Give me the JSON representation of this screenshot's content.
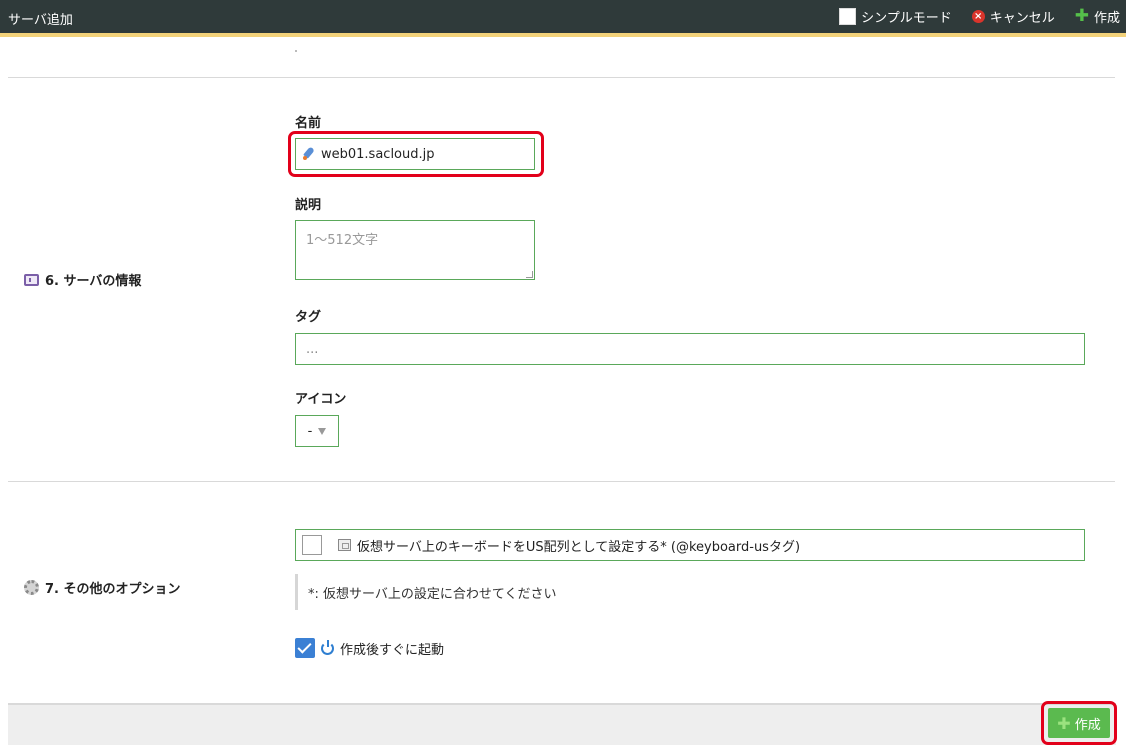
{
  "header": {
    "title": "サーバ追加",
    "simple_mode_label": "シンプルモード",
    "cancel_label": "キャンセル",
    "create_label": "作成",
    "accent_color": "#f3d27a"
  },
  "sections": {
    "server_info": {
      "label": "6. サーバの情報",
      "icon": "info-card-icon",
      "fields": {
        "name_label": "名前",
        "name_value": "web01.sacloud.jp",
        "description_label": "説明",
        "description_placeholder": "1～512文字",
        "tag_label": "タグ",
        "tag_value": "...",
        "icon_label": "アイコン",
        "icon_value": "-"
      }
    },
    "other_options": {
      "label": "7. その他のオプション",
      "icon": "gear-icon",
      "keyboard_option_label": "仮想サーバ上のキーボードをUS配列として設定する* (@keyboard-usタグ)",
      "keyboard_checked": false,
      "note": "*: 仮想サーバ上の設定に合わせてください",
      "boot_label": "作成後すぐに起動",
      "boot_checked": true
    }
  },
  "footer": {
    "create_label": "作成",
    "button_color": "#5bba4f",
    "highlight_color": "#e2001a"
  }
}
